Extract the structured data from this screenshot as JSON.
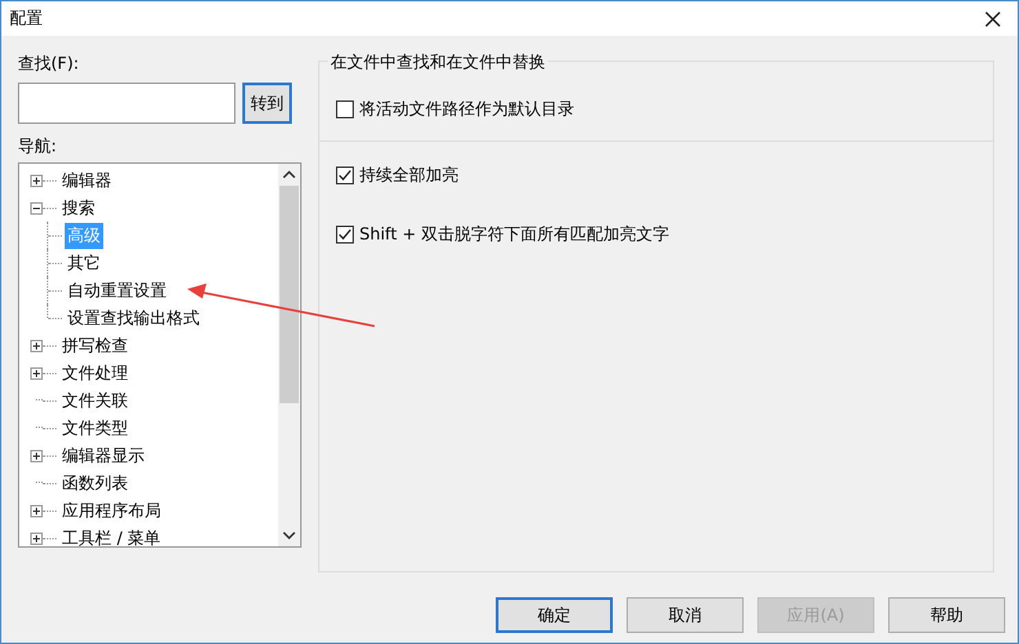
{
  "window": {
    "title": "配置"
  },
  "search": {
    "label": "查找(F):",
    "button": "转到"
  },
  "navigation": {
    "label": "导航:",
    "tree": [
      {
        "label": "编辑器",
        "expanded": false,
        "selected": false
      },
      {
        "label": "搜索",
        "expanded": true,
        "selected": false,
        "children": [
          {
            "label": "高级",
            "selected": true
          },
          {
            "label": "其它",
            "selected": false
          },
          {
            "label": "自动重置设置",
            "selected": false
          },
          {
            "label": "设置查找输出格式",
            "selected": false
          }
        ]
      },
      {
        "label": "拼写检查",
        "expanded": false,
        "selected": false
      },
      {
        "label": "文件处理",
        "expanded": false,
        "selected": false
      },
      {
        "label": "文件关联",
        "selected": false
      },
      {
        "label": "文件类型",
        "selected": false
      },
      {
        "label": "编辑器显示",
        "expanded": false,
        "selected": false
      },
      {
        "label": "函数列表",
        "selected": false
      },
      {
        "label": "应用程序布局",
        "expanded": false,
        "selected": false
      },
      {
        "label": "工具栏 / 菜单",
        "expanded": false,
        "selected": false
      }
    ]
  },
  "group": {
    "title": "在文件中查找和在文件中替换",
    "sections": [
      [
        {
          "label": "将活动文件路径作为默认目录",
          "checked": false
        }
      ],
      [
        {
          "label": "持续全部加亮",
          "checked": true
        },
        {
          "label": "Shift + 双击脱字符下面所有匹配加亮文字",
          "checked": true
        }
      ]
    ]
  },
  "buttons": [
    {
      "label": "确定",
      "default": true,
      "disabled": false
    },
    {
      "label": "取消",
      "default": false,
      "disabled": false
    },
    {
      "label": "应用(A)",
      "default": false,
      "disabled": true
    },
    {
      "label": "帮助",
      "default": false,
      "disabled": false
    }
  ]
}
